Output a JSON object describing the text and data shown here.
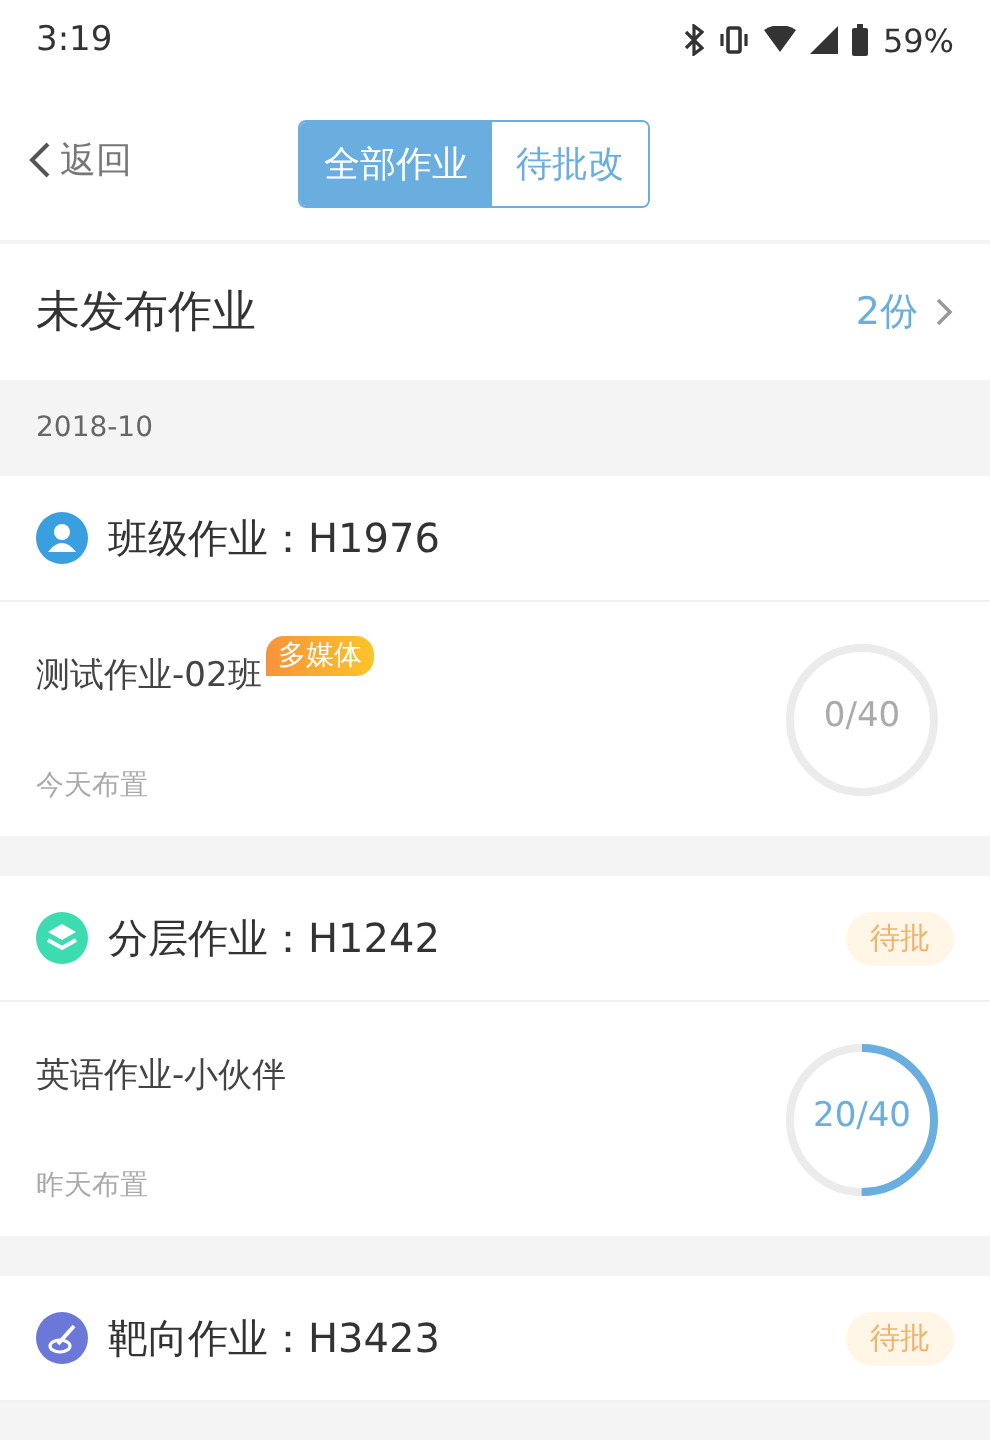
{
  "status_bar": {
    "time": "3:19",
    "battery": "59%"
  },
  "nav": {
    "back": "返回",
    "tabs": [
      {
        "label": "全部作业",
        "selected": true
      },
      {
        "label": "待批改",
        "selected": false
      }
    ]
  },
  "unpublished": {
    "title": "未发布作业",
    "count": "2份"
  },
  "date_header": "2018-10",
  "cards": [
    {
      "kind": "class",
      "title": "班级作业：H1976",
      "name": "测试作业-02班",
      "tag": "多媒体",
      "date": "今天布置",
      "reading": "0/40"
    },
    {
      "kind": "layered",
      "title": "分层作业：H1242",
      "badge": "待批",
      "name": "英语作业-小伙伴",
      "date": "昨天布置",
      "reading": "20/40"
    },
    {
      "kind": "targeted",
      "title": "靶向作业：H3423",
      "badge": "待批"
    }
  ]
}
